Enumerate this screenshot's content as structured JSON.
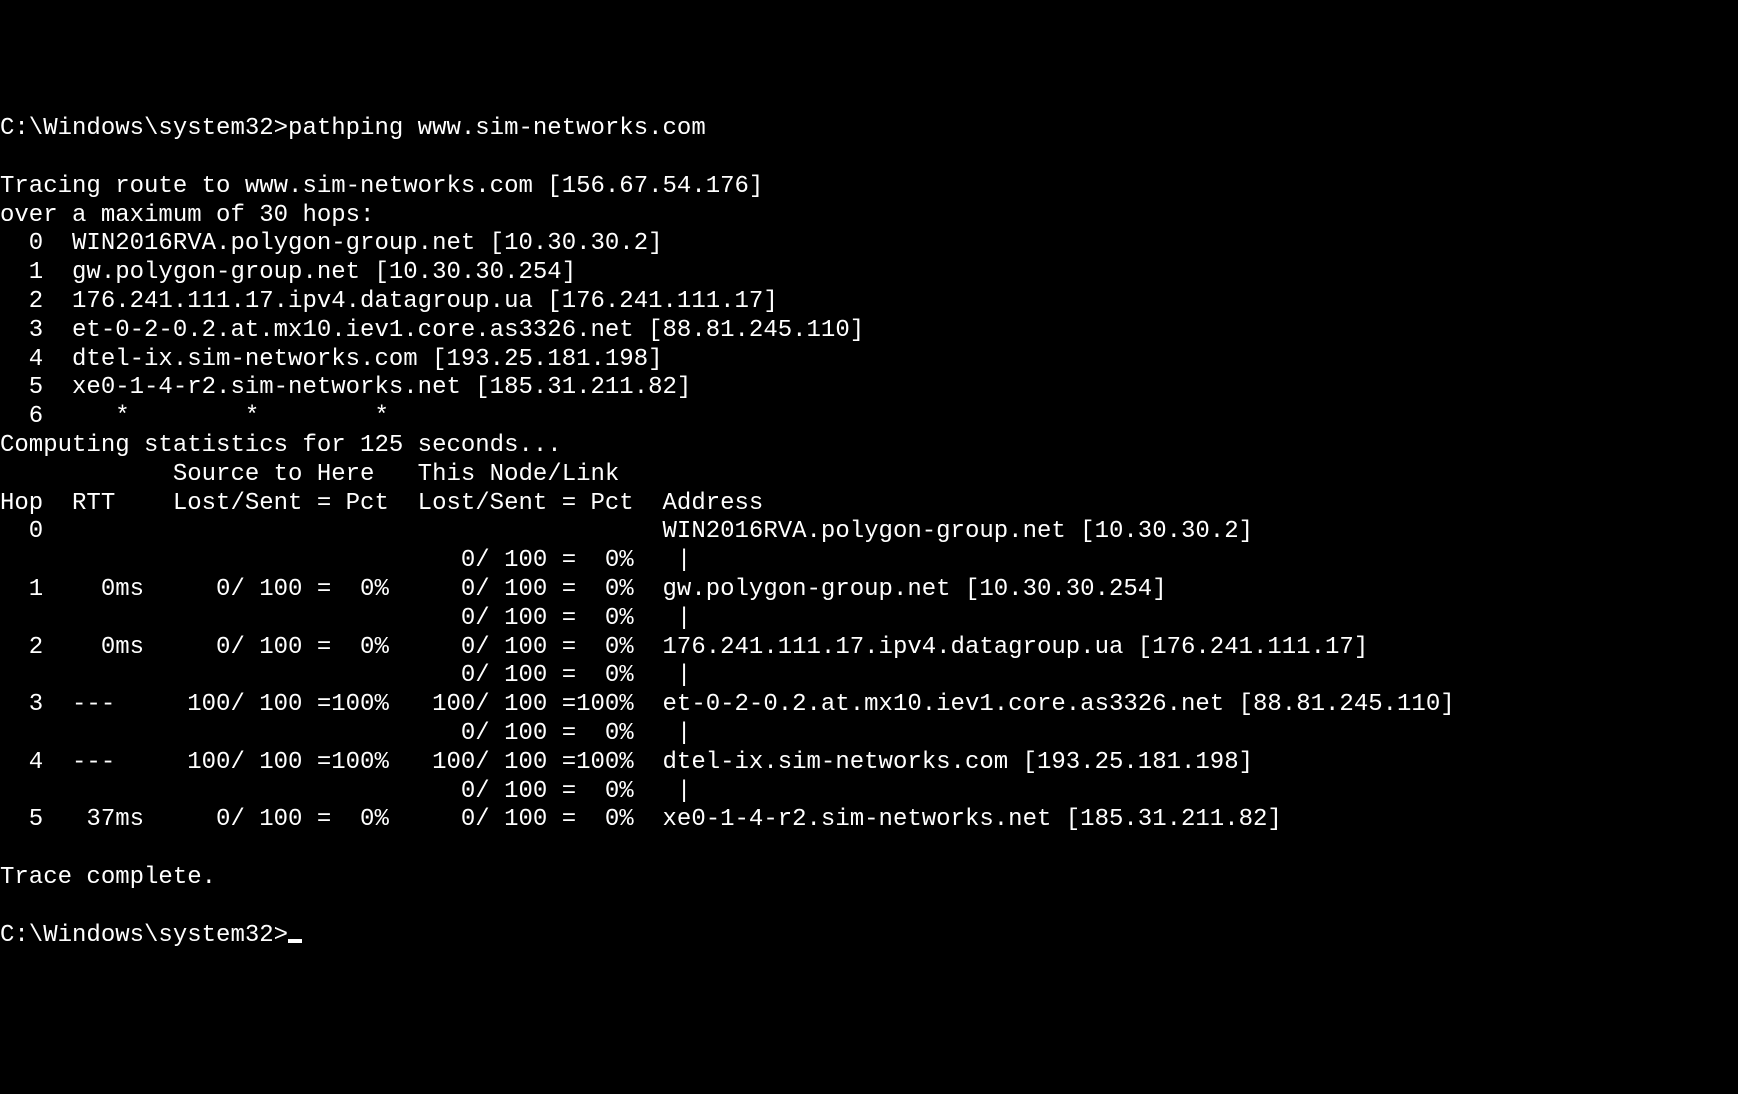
{
  "prompt1": "C:\\Windows\\system32>",
  "command": "pathping www.sim-networks.com",
  "blank": "",
  "tracing_line1": "Tracing route to www.sim-networks.com [156.67.54.176]",
  "tracing_line2": "over a maximum of 30 hops:",
  "trace_hops": [
    "  0  WIN2016RVA.polygon-group.net [10.30.30.2]",
    "  1  gw.polygon-group.net [10.30.30.254]",
    "  2  176.241.111.17.ipv4.datagroup.ua [176.241.111.17]",
    "  3  et-0-2-0.2.at.mx10.iev1.core.as3326.net [88.81.245.110]",
    "  4  dtel-ix.sim-networks.com [193.25.181.198]",
    "  5  xe0-1-4-r2.sim-networks.net [185.31.211.82]",
    "  6     *        *        *"
  ],
  "computing_line": "Computing statistics for 125 seconds...",
  "stats_header1": "            Source to Here   This Node/Link",
  "stats_header2": "Hop  RTT    Lost/Sent = Pct  Lost/Sent = Pct  Address",
  "stats_rows": [
    "  0                                           WIN2016RVA.polygon-group.net [10.30.30.2]",
    "                                0/ 100 =  0%   |",
    "  1    0ms     0/ 100 =  0%     0/ 100 =  0%  gw.polygon-group.net [10.30.30.254]",
    "                                0/ 100 =  0%   |",
    "  2    0ms     0/ 100 =  0%     0/ 100 =  0%  176.241.111.17.ipv4.datagroup.ua [176.241.111.17]",
    "                                0/ 100 =  0%   |",
    "  3  ---     100/ 100 =100%   100/ 100 =100%  et-0-2-0.2.at.mx10.iev1.core.as3326.net [88.81.245.110]",
    "                                0/ 100 =  0%   |",
    "  4  ---     100/ 100 =100%   100/ 100 =100%  dtel-ix.sim-networks.com [193.25.181.198]",
    "                                0/ 100 =  0%   |",
    "  5   37ms     0/ 100 =  0%     0/ 100 =  0%  xe0-1-4-r2.sim-networks.net [185.31.211.82]"
  ],
  "trace_complete": "Trace complete.",
  "prompt2": "C:\\Windows\\system32>",
  "chart_data": {
    "type": "table",
    "title": "pathping statistics",
    "columns": [
      "Hop",
      "RTT",
      "Source_Lost",
      "Source_Sent",
      "Source_Pct",
      "Node_Lost",
      "Node_Sent",
      "Node_Pct",
      "Address"
    ],
    "rows": [
      {
        "Hop": 0,
        "RTT": null,
        "Source_Lost": null,
        "Source_Sent": null,
        "Source_Pct": null,
        "Node_Lost": null,
        "Node_Sent": null,
        "Node_Pct": null,
        "Address": "WIN2016RVA.polygon-group.net [10.30.30.2]"
      },
      {
        "Hop": 1,
        "RTT": "0ms",
        "Source_Lost": 0,
        "Source_Sent": 100,
        "Source_Pct": 0,
        "Node_Lost": 0,
        "Node_Sent": 100,
        "Node_Pct": 0,
        "Address": "gw.polygon-group.net [10.30.30.254]"
      },
      {
        "Hop": 2,
        "RTT": "0ms",
        "Source_Lost": 0,
        "Source_Sent": 100,
        "Source_Pct": 0,
        "Node_Lost": 0,
        "Node_Sent": 100,
        "Node_Pct": 0,
        "Address": "176.241.111.17.ipv4.datagroup.ua [176.241.111.17]"
      },
      {
        "Hop": 3,
        "RTT": "---",
        "Source_Lost": 100,
        "Source_Sent": 100,
        "Source_Pct": 100,
        "Node_Lost": 100,
        "Node_Sent": 100,
        "Node_Pct": 100,
        "Address": "et-0-2-0.2.at.mx10.iev1.core.as3326.net [88.81.245.110]"
      },
      {
        "Hop": 4,
        "RTT": "---",
        "Source_Lost": 100,
        "Source_Sent": 100,
        "Source_Pct": 100,
        "Node_Lost": 100,
        "Node_Sent": 100,
        "Node_Pct": 100,
        "Address": "dtel-ix.sim-networks.com [193.25.181.198]"
      },
      {
        "Hop": 5,
        "RTT": "37ms",
        "Source_Lost": 0,
        "Source_Sent": 100,
        "Source_Pct": 0,
        "Node_Lost": 0,
        "Node_Sent": 100,
        "Node_Pct": 0,
        "Address": "xe0-1-4-r2.sim-networks.net [185.31.211.82]"
      }
    ]
  }
}
